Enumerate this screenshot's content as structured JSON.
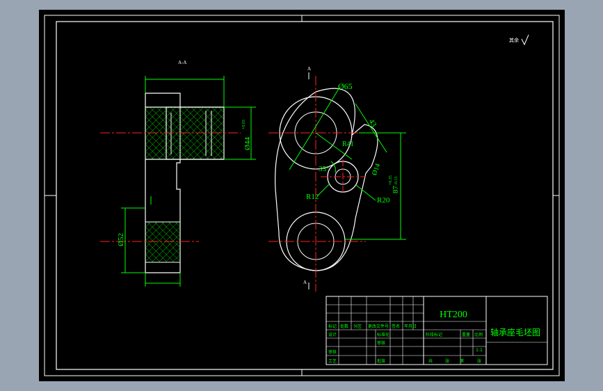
{
  "title_block": {
    "material": "HT200",
    "drawing_title": "轴承座毛坯图",
    "scale": "1:1",
    "row_labels": [
      "标记",
      "处数",
      "分区",
      "更改文件号",
      "签名",
      "年月日"
    ],
    "left_labels": [
      "设计",
      "审核",
      "工艺"
    ],
    "mid_labels": [
      "标准化",
      "审核",
      "批准"
    ],
    "right_labels": [
      "阶段标记",
      "重量",
      "比例"
    ],
    "sheet_labels": [
      "共",
      "张",
      "第",
      "张"
    ]
  },
  "dimensions": {
    "phi65": "Ø65",
    "r41": "R41",
    "angle35": "35°",
    "r12": "R12",
    "r20": "R20",
    "dim43": "43",
    "phi14": "Ø14",
    "dim87": "87",
    "tol87_upper": "+0.35",
    "tol87_lower": "-0.15",
    "phi44": "Ø44",
    "tol44": "+0.03",
    "phi52": "Ø52",
    "section_label_a_top": "A",
    "section_label_a_bottom": "A",
    "section_view_label": "A-A",
    "roughness_note": "其余"
  },
  "colors": {
    "background": "#000000",
    "outline": "#ffffff",
    "dimension": "#00ff00",
    "centerline": "#ff2020",
    "hatch": "#00ff00"
  }
}
